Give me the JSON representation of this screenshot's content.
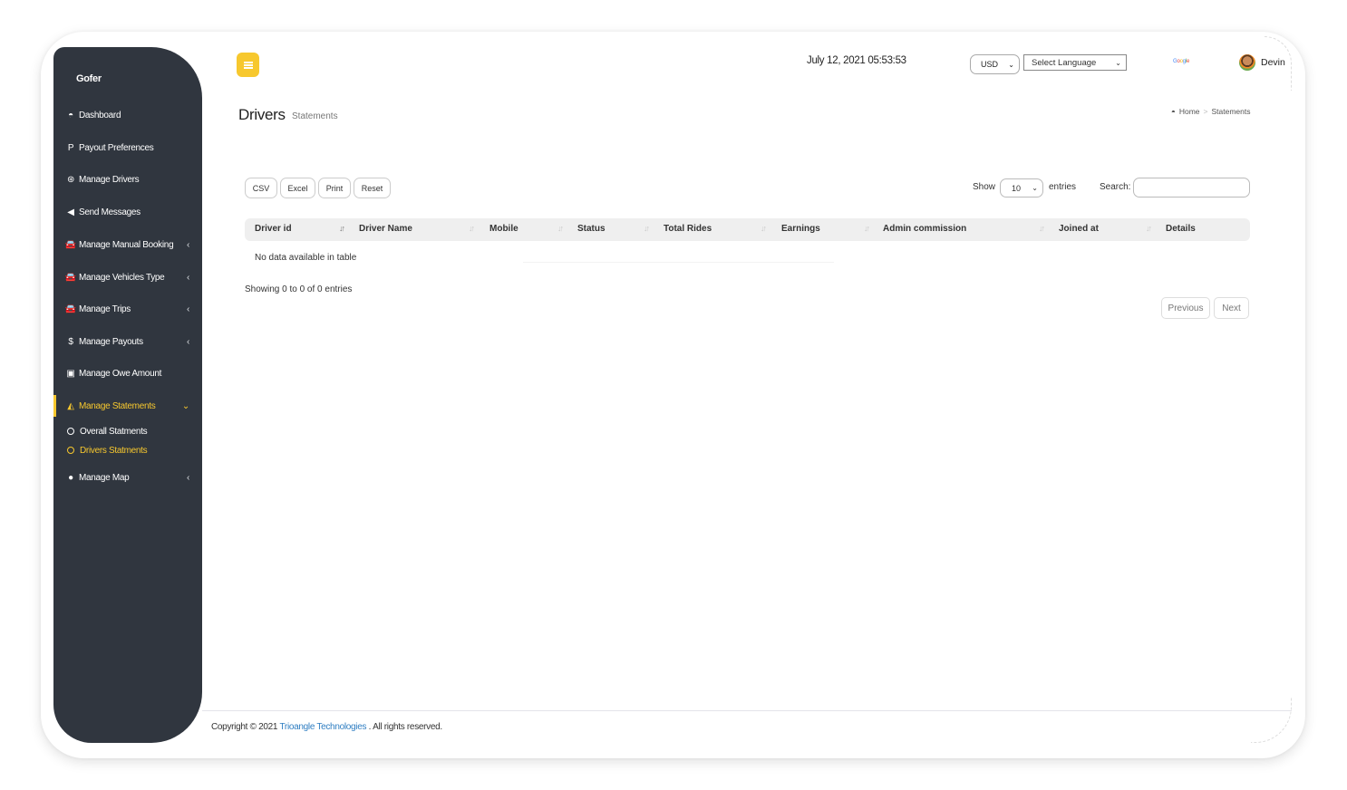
{
  "app": {
    "brand": "Gofer"
  },
  "sidebar": {
    "items": [
      {
        "label": "Dashboard",
        "icon": "dashboard-icon",
        "glyph": "◓",
        "has_chevron": false
      },
      {
        "label": "Payout Preferences",
        "icon": "paypal-icon",
        "glyph": "P",
        "has_chevron": false
      },
      {
        "label": "Manage Drivers",
        "icon": "dribbble-icon",
        "glyph": "⊛",
        "has_chevron": false
      },
      {
        "label": "Send Messages",
        "icon": "bullhorn-icon",
        "glyph": "◀",
        "has_chevron": false
      },
      {
        "label": "Manage Manual Booking",
        "icon": "taxi-icon",
        "glyph": "🚘",
        "has_chevron": true,
        "chevron": "‹"
      },
      {
        "label": "Manage Vehicles Type",
        "icon": "taxi-icon",
        "glyph": "🚘",
        "has_chevron": true,
        "chevron": "‹"
      },
      {
        "label": "Manage Trips",
        "icon": "taxi-icon",
        "glyph": "🚘",
        "has_chevron": true,
        "chevron": "‹"
      },
      {
        "label": "Manage Payouts",
        "icon": "dollar-icon",
        "glyph": "$",
        "has_chevron": true,
        "chevron": "‹"
      },
      {
        "label": "Manage Owe Amount",
        "icon": "money-icon",
        "glyph": "▣",
        "has_chevron": false
      },
      {
        "label": "Manage Statements",
        "icon": "area-chart-icon",
        "glyph": "◭",
        "has_chevron": true,
        "chevron": "⌄",
        "active": true
      },
      {
        "label": "Manage Map",
        "icon": "map-marker-icon",
        "glyph": "●",
        "has_chevron": true,
        "chevron": "‹"
      }
    ],
    "sub_items": [
      {
        "label": "Overall Statments",
        "active": false
      },
      {
        "label": "Drivers Statments",
        "active": true
      }
    ]
  },
  "header": {
    "datetime": "July 12, 2021 05:53:53",
    "currency": "USD",
    "language_placeholder": "Select Language",
    "translate_brand": "Google",
    "user_name": "Devin"
  },
  "page": {
    "title": "Drivers",
    "subtitle": "Statements",
    "breadcrumb": {
      "home": "Home",
      "separator": ">",
      "current": "Statements"
    }
  },
  "table_tools": {
    "buttons": [
      "CSV",
      "Excel",
      "Print",
      "Reset"
    ],
    "show_label": "Show",
    "page_length": "10",
    "entries_label": "entries",
    "search_label": "Search:",
    "search_value": ""
  },
  "table": {
    "columns": [
      "Driver id",
      "Driver Name",
      "Mobile",
      "Status",
      "Total Rides",
      "Earnings",
      "Admin commission",
      "Joined at",
      "Details"
    ],
    "rows": [],
    "empty_message": "No data available in table",
    "info": "Showing 0 to 0 of 0 entries",
    "pagination": {
      "previous": "Previous",
      "next": "Next"
    }
  },
  "footer": {
    "prefix": "Copyright © 2021",
    "company": "Trioangle Technologies",
    "suffix": ". All rights reserved."
  },
  "colors": {
    "accent": "#f7c82e",
    "sidebar_bg": "#30363f",
    "link": "#2f7ec2"
  }
}
